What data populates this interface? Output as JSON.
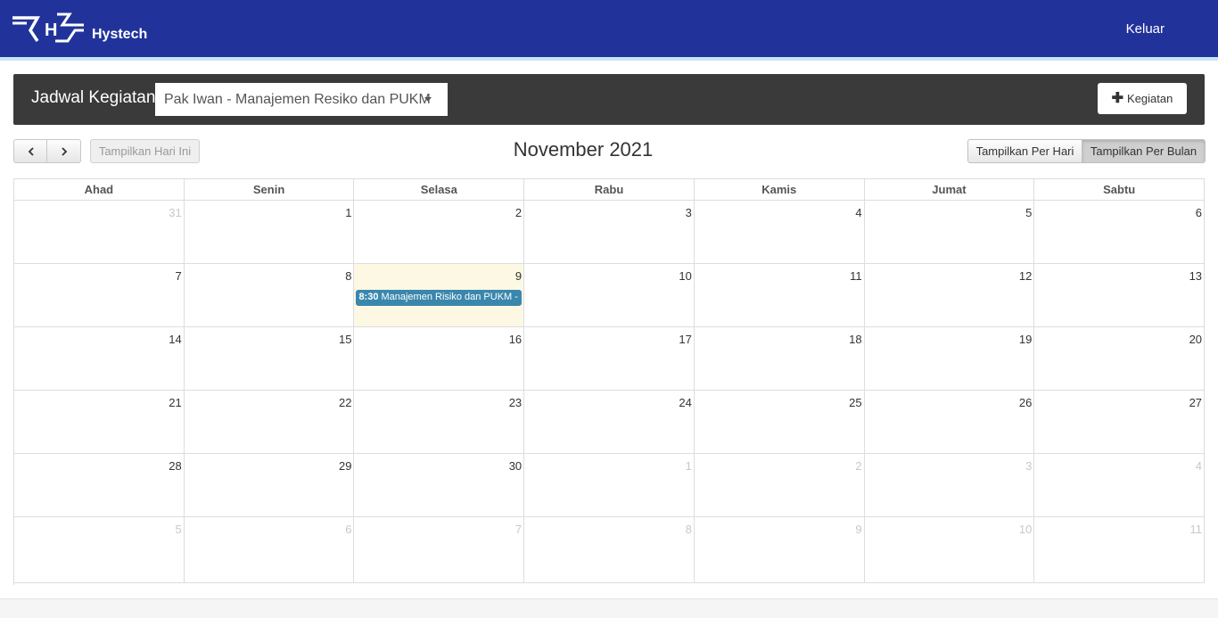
{
  "header": {
    "brand": "Hystech",
    "logo_text": "H",
    "logout": "Keluar",
    "bar_color": "#21339b"
  },
  "panel": {
    "title": "Jadwal Kegiatan",
    "selected_schedule": "Pak Iwan - Manajemen Resiko dan PUKM",
    "add_button": "Kegiatan",
    "add_icon": "plus-icon"
  },
  "toolbar": {
    "today_button": "Tampilkan Hari Ini",
    "prev_icon": "chevron-left-icon",
    "next_icon": "chevron-right-icon",
    "month_title": "November 2021",
    "view_day": "Tampilkan Per Hari",
    "view_month": "Tampilkan Per Bulan",
    "active_view": "month"
  },
  "calendar": {
    "day_names": [
      "Ahad",
      "Senin",
      "Selasa",
      "Rabu",
      "Kamis",
      "Jumat",
      "Sabtu"
    ],
    "weeks": [
      [
        {
          "d": "31",
          "other": true
        },
        {
          "d": "1"
        },
        {
          "d": "2"
        },
        {
          "d": "3"
        },
        {
          "d": "4"
        },
        {
          "d": "5"
        },
        {
          "d": "6"
        }
      ],
      [
        {
          "d": "7"
        },
        {
          "d": "8"
        },
        {
          "d": "9",
          "today": true
        },
        {
          "d": "10"
        },
        {
          "d": "11"
        },
        {
          "d": "12"
        },
        {
          "d": "13"
        }
      ],
      [
        {
          "d": "14"
        },
        {
          "d": "15"
        },
        {
          "d": "16"
        },
        {
          "d": "17"
        },
        {
          "d": "18"
        },
        {
          "d": "19"
        },
        {
          "d": "20"
        }
      ],
      [
        {
          "d": "21"
        },
        {
          "d": "22"
        },
        {
          "d": "23"
        },
        {
          "d": "24"
        },
        {
          "d": "25"
        },
        {
          "d": "26"
        },
        {
          "d": "27"
        }
      ],
      [
        {
          "d": "28"
        },
        {
          "d": "29"
        },
        {
          "d": "30"
        },
        {
          "d": "1",
          "other": true
        },
        {
          "d": "2",
          "other": true
        },
        {
          "d": "3",
          "other": true
        },
        {
          "d": "4",
          "other": true
        }
      ],
      [
        {
          "d": "5",
          "other": true
        },
        {
          "d": "6",
          "other": true
        },
        {
          "d": "7",
          "other": true
        },
        {
          "d": "8",
          "other": true
        },
        {
          "d": "9",
          "other": true
        },
        {
          "d": "10",
          "other": true
        },
        {
          "d": "11",
          "other": true
        }
      ]
    ],
    "events": [
      {
        "week": 1,
        "day": 2,
        "time": "8:30",
        "title": "Manajemen Risiko dan PUKM - Pak Iwan",
        "color": "#3a87ad"
      }
    ],
    "today_color": "#fcf8e3"
  }
}
